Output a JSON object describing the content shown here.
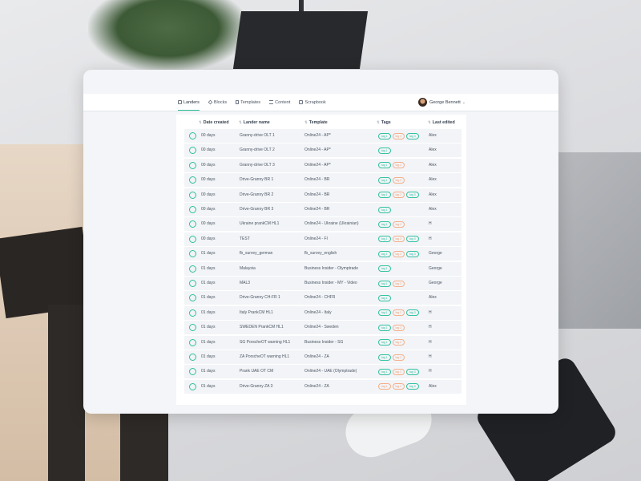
{
  "nav": [
    {
      "label": "Landers",
      "icon": "landers-icon",
      "active": true
    },
    {
      "label": "Blocks",
      "icon": "blocks-icon",
      "active": false
    },
    {
      "label": "Templates",
      "icon": "templates-icon",
      "active": false
    },
    {
      "label": "Content",
      "icon": "content-icon",
      "active": false
    },
    {
      "label": "Scrapbook",
      "icon": "scrapbook-icon",
      "active": false
    }
  ],
  "user": {
    "name": "George Bennett"
  },
  "columns": {
    "date_created": "Date created",
    "lander_name": "Lander name",
    "template": "Template",
    "tags": "Tags",
    "last_edited": "Last edited"
  },
  "colors": {
    "accent": "#2fbf9a",
    "tag_teal": "#34c3a1",
    "tag_orange": "#f4a178"
  },
  "rows": [
    {
      "date": "00 days",
      "name": "Granny-drive OLT 1",
      "template": "Online24 - AP*",
      "tags": [
        [
          "tag 1",
          "teal"
        ],
        [
          "tag 2",
          "orange"
        ],
        [
          "tag 3",
          "teal"
        ]
      ],
      "edited": "Alex"
    },
    {
      "date": "00 days",
      "name": "Granny-drive OLT 2",
      "template": "Online24 - AP*",
      "tags": [
        [
          "tag 1",
          "teal"
        ]
      ],
      "edited": "Alex"
    },
    {
      "date": "00 days",
      "name": "Granny-drive OLT 3",
      "template": "Online24 - AP*",
      "tags": [
        [
          "tag 1",
          "teal"
        ],
        [
          "tag 2",
          "orange"
        ]
      ],
      "edited": "Alex"
    },
    {
      "date": "00 days",
      "name": "Drive-Granny BR 1",
      "template": "Online24 - BR",
      "tags": [
        [
          "tag 1",
          "teal"
        ],
        [
          "tag 2",
          "orange"
        ]
      ],
      "edited": "Alex"
    },
    {
      "date": "00 days",
      "name": "Drive-Granny BR 2",
      "template": "Online24 - BR",
      "tags": [
        [
          "tag 1",
          "teal"
        ],
        [
          "tag 2",
          "orange"
        ],
        [
          "tag 3",
          "teal"
        ]
      ],
      "edited": "Alex"
    },
    {
      "date": "00 days",
      "name": "Drive-Granny BR 3",
      "template": "Online24 - BR",
      "tags": [
        [
          "tag 1",
          "teal"
        ]
      ],
      "edited": "Alex"
    },
    {
      "date": "00 days",
      "name": "Ukraine prankCM HL1",
      "template": "Online24 - Ukraine (Ukrainian)",
      "tags": [
        [
          "tag 1",
          "teal"
        ],
        [
          "tag 2",
          "orange"
        ]
      ],
      "edited": "H"
    },
    {
      "date": "00 days",
      "name": "TEST",
      "template": "Online24 - FI",
      "tags": [
        [
          "tag 1",
          "teal"
        ],
        [
          "tag 2",
          "orange"
        ],
        [
          "tag 3",
          "teal"
        ]
      ],
      "edited": "H"
    },
    {
      "date": "01 days",
      "name": "fb_survey_german",
      "template": "fb_survey_english",
      "tags": [
        [
          "tag 1",
          "teal"
        ],
        [
          "tag 2",
          "orange"
        ],
        [
          "tag 3",
          "teal"
        ]
      ],
      "edited": "George"
    },
    {
      "date": "01 days",
      "name": "Malaysia",
      "template": "Business Insider - Olymptrade",
      "tags": [
        [
          "tag 1",
          "teal"
        ]
      ],
      "edited": "George"
    },
    {
      "date": "01 days",
      "name": "MAL3",
      "template": "Business Insider - MY - Video",
      "tags": [
        [
          "tag 1",
          "teal"
        ],
        [
          "tag 2",
          "orange"
        ]
      ],
      "edited": "George"
    },
    {
      "date": "01 days",
      "name": "Drive-Granny CH-FR 1",
      "template": "Online24 - CHFR",
      "tags": [
        [
          "tag 1",
          "teal"
        ]
      ],
      "edited": "Alex"
    },
    {
      "date": "01 days",
      "name": "Italy PrankCM HL1",
      "template": "Online24 - Italy",
      "tags": [
        [
          "tag 1",
          "teal"
        ],
        [
          "tag 2",
          "orange"
        ],
        [
          "tag 3",
          "teal"
        ]
      ],
      "edited": "H"
    },
    {
      "date": "01 days",
      "name": "SWEDEN PrankCM HL1",
      "template": "Online24 - Sweden",
      "tags": [
        [
          "tag 1",
          "teal"
        ],
        [
          "tag 2",
          "orange"
        ]
      ],
      "edited": "H"
    },
    {
      "date": "01 days",
      "name": "SG PorscheOT warning HL1",
      "template": "Business Insider - SG",
      "tags": [
        [
          "tag 1",
          "teal"
        ],
        [
          "tag 2",
          "orange"
        ]
      ],
      "edited": "H"
    },
    {
      "date": "01 days",
      "name": "ZA PorscheOT warning HL1",
      "template": "Online24 - ZA",
      "tags": [
        [
          "tag 1",
          "teal"
        ],
        [
          "tag 2",
          "orange"
        ]
      ],
      "edited": "H"
    },
    {
      "date": "01 days",
      "name": "Prank UAE OT CM",
      "template": "Online24 - UAE (Olymptrade)",
      "tags": [
        [
          "tag 1",
          "teal"
        ],
        [
          "tag 2",
          "orange"
        ],
        [
          "tag 3",
          "teal"
        ]
      ],
      "edited": "H"
    },
    {
      "date": "01 days",
      "name": "Drive-Granny ZA 3",
      "template": "Online24 - ZA",
      "tags": [
        [
          "tag 1",
          "orange"
        ],
        [
          "tag 2",
          "orange"
        ],
        [
          "tag 3",
          "teal"
        ]
      ],
      "edited": "Alex"
    }
  ]
}
